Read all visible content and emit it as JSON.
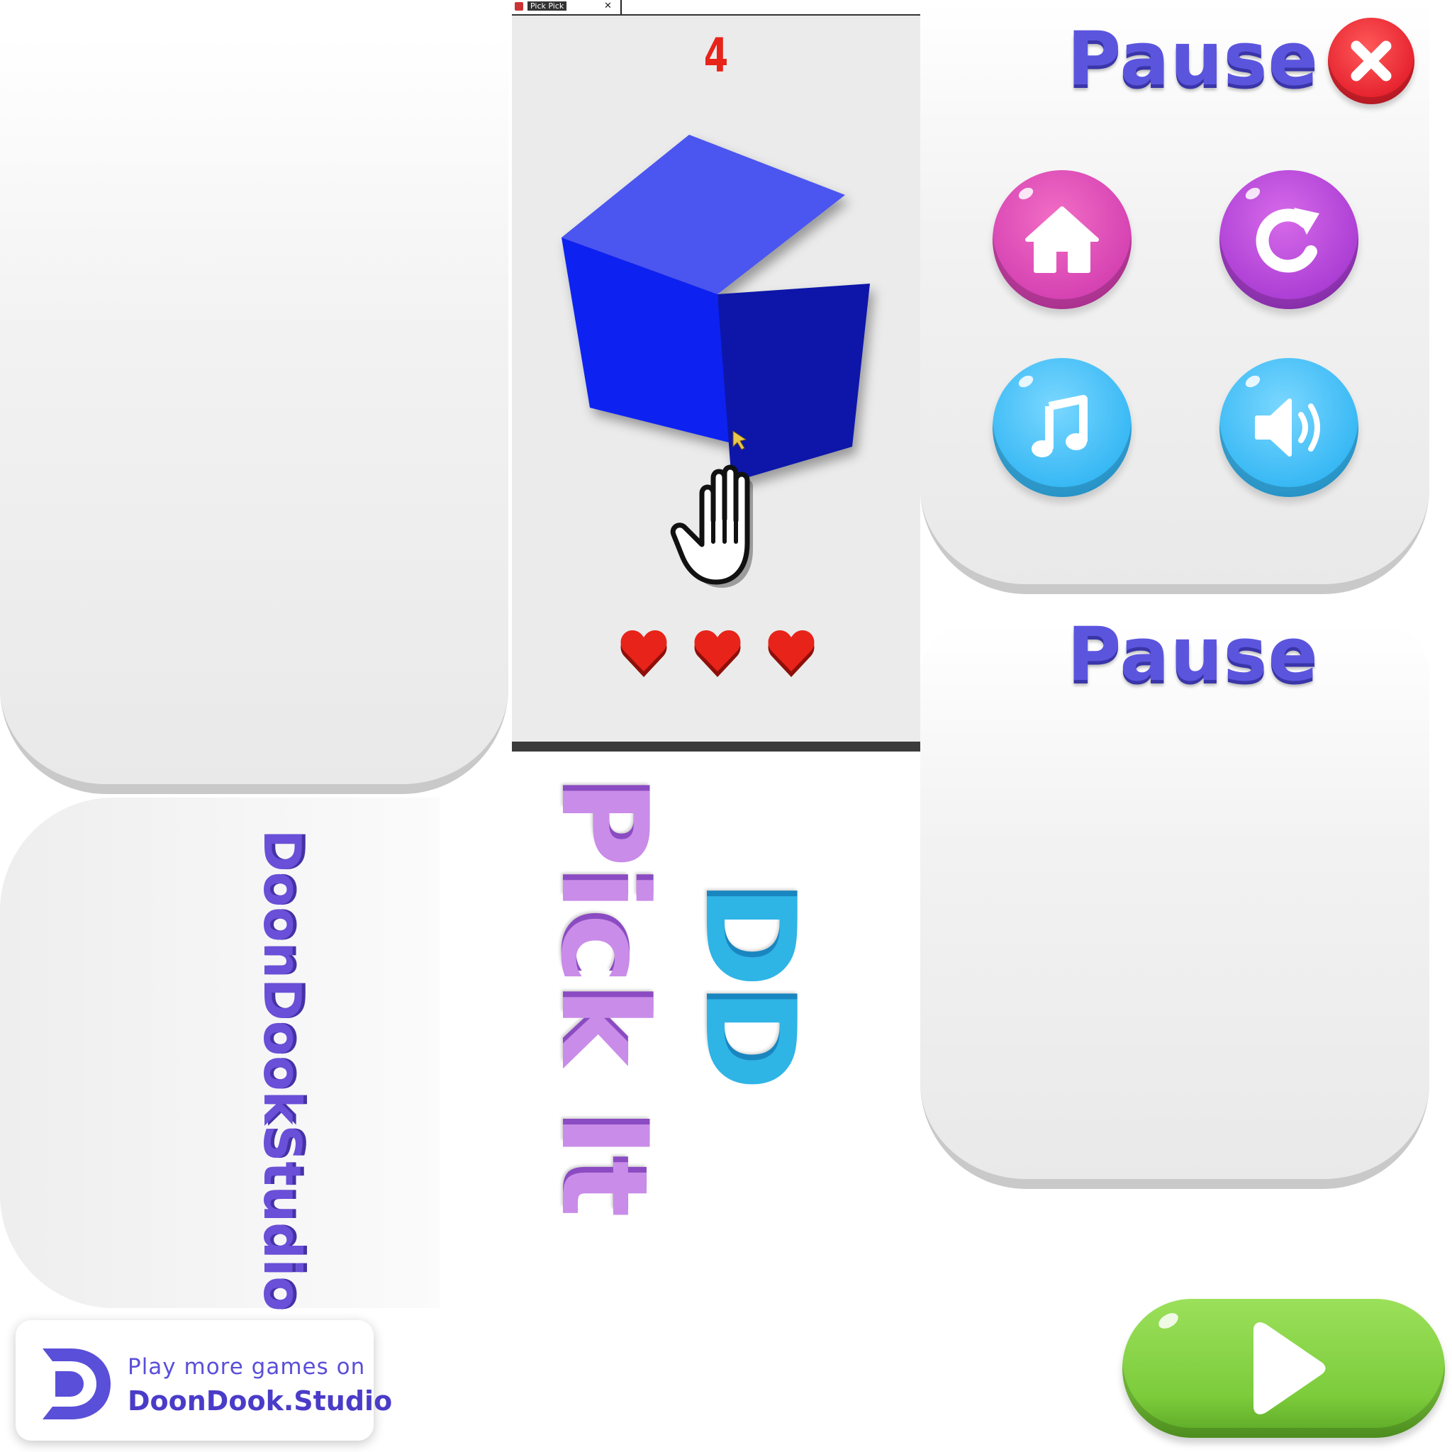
{
  "window": {
    "title": "Pick Pick",
    "close_glyph": "✕"
  },
  "game": {
    "score": "4",
    "lives": 3,
    "cube_color": "#1020f0"
  },
  "pause_menu": {
    "title": "Pause",
    "buttons": [
      {
        "name": "home",
        "icon": "home-icon"
      },
      {
        "name": "restart",
        "icon": "restart-icon"
      },
      {
        "name": "music",
        "icon": "music-note-icon"
      },
      {
        "name": "sound",
        "icon": "speaker-icon"
      }
    ],
    "close_icon": "close-icon"
  },
  "pause_panel_blank": {
    "title": "Pause"
  },
  "branding": {
    "studio_name": "DoonDookStudio",
    "game_title": "Pick It",
    "logo_letters": "DD"
  },
  "promo": {
    "line1": "Play more games on",
    "line2": "DoonDook.Studio"
  },
  "colors": {
    "title_purple": "#5b55de",
    "heart_red": "#e7231a",
    "play_green": "#7ccc3c"
  }
}
